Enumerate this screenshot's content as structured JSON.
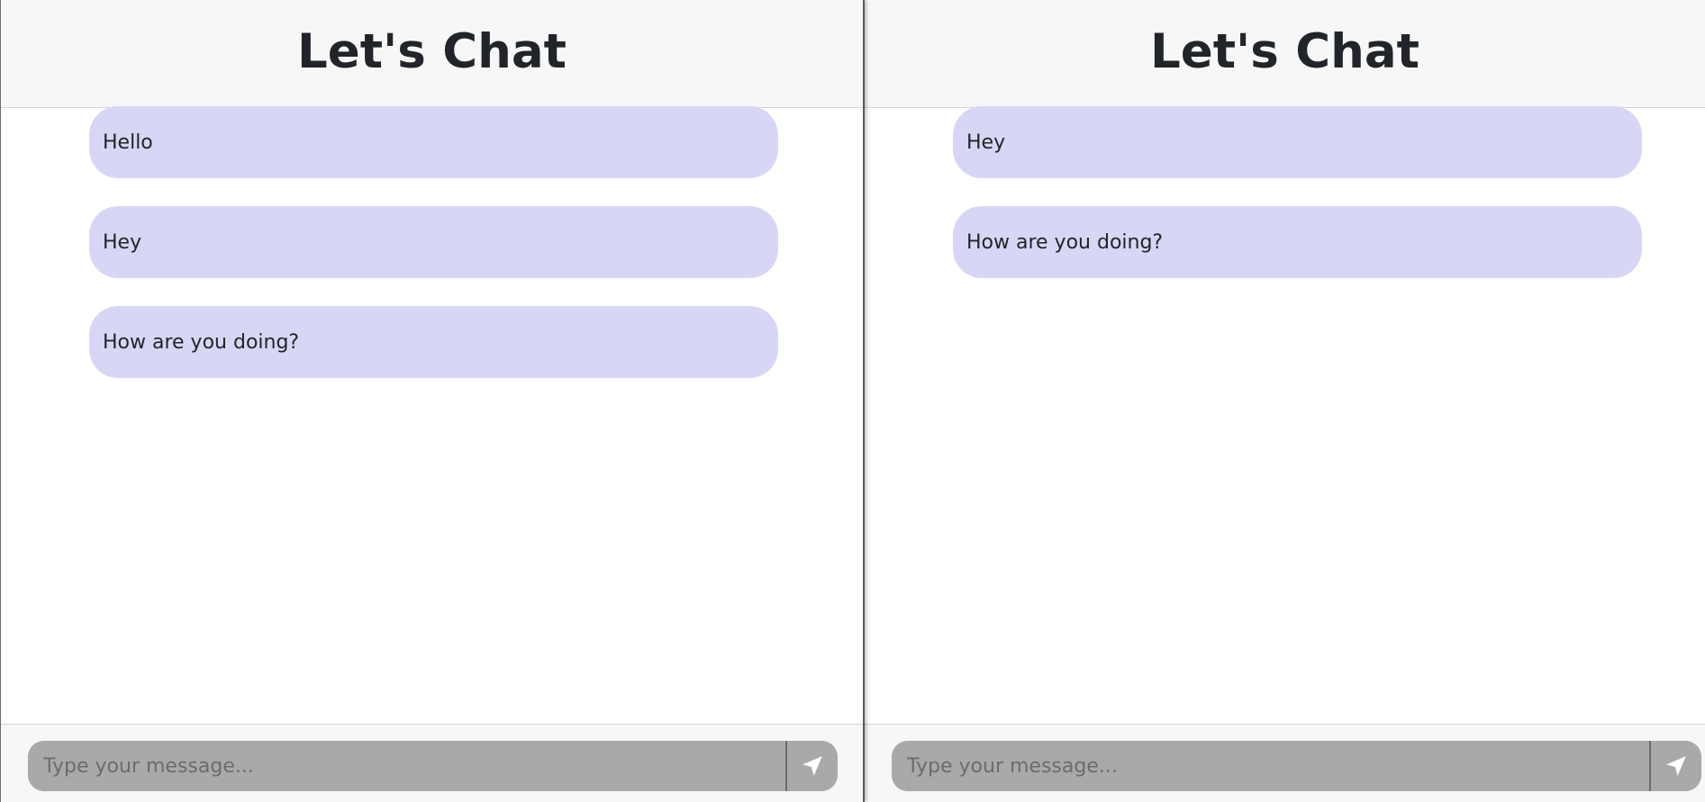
{
  "left_pane": {
    "header": {
      "title": "Let's Chat"
    },
    "messages": [
      {
        "text": "Hello"
      },
      {
        "text": "Hey"
      },
      {
        "text": "How are you doing?"
      }
    ],
    "composer": {
      "placeholder": "Type your message...",
      "value": "",
      "send_icon": "send-icon"
    }
  },
  "right_pane": {
    "header": {
      "title": "Let's Chat"
    },
    "messages": [
      {
        "text": "Hey"
      },
      {
        "text": "How are you doing?"
      }
    ],
    "composer": {
      "placeholder": "Type your message...",
      "value": "",
      "send_icon": "send-icon"
    }
  },
  "colors": {
    "bubble": "#d7d7f5",
    "header_bg": "#f7f7f7",
    "input_bg": "#a9a9a9",
    "title_text": "#212529"
  }
}
